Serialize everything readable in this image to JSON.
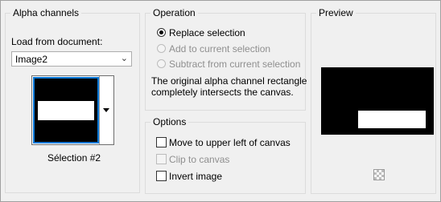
{
  "alpha_channels": {
    "title": "Alpha channels",
    "load_label": "Load from document:",
    "document": "Image2",
    "selection_name": "Sélection #2"
  },
  "operation": {
    "title": "Operation",
    "options": [
      {
        "label": "Replace selection",
        "checked": true,
        "enabled": true
      },
      {
        "label": "Add to current selection",
        "checked": false,
        "enabled": false
      },
      {
        "label": "Subtract from current selection",
        "checked": false,
        "enabled": false
      }
    ],
    "message_line1": "The original alpha channel rectangle",
    "message_line2": "completely intersects the canvas."
  },
  "options": {
    "title": "Options",
    "items": [
      {
        "label": "Move to upper left of canvas",
        "checked": false,
        "enabled": true
      },
      {
        "label": "Clip to canvas",
        "checked": false,
        "enabled": false
      },
      {
        "label": "Invert image",
        "checked": false,
        "enabled": true
      }
    ]
  },
  "preview": {
    "title": "Preview",
    "zoom_icon": "checkerboard-icon"
  }
}
